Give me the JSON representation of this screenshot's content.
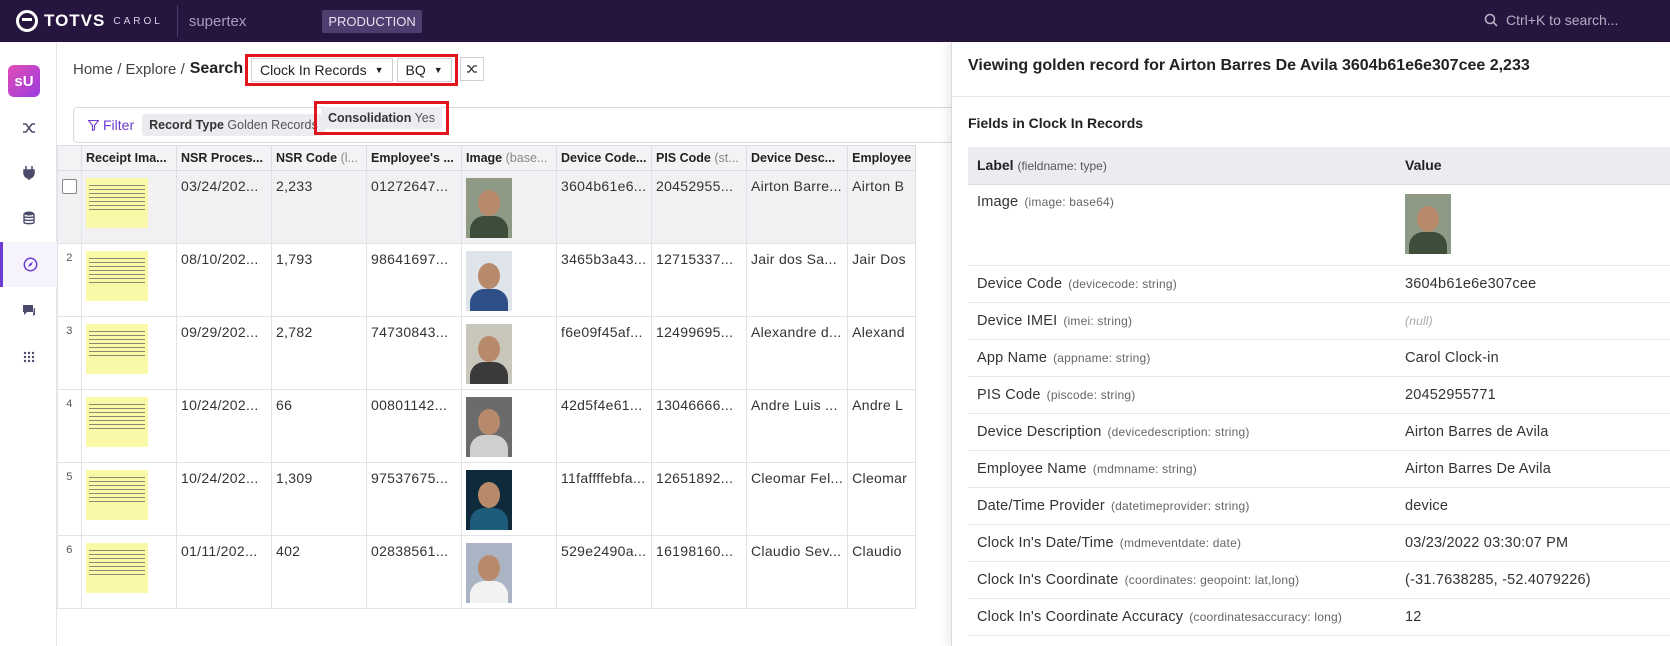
{
  "topbar": {
    "logo_text": "TOTVS",
    "logo_sub": "CAROL",
    "tenant": "supertex",
    "environment": "PRODUCTION",
    "search_placeholder": "Ctrl+K to search..."
  },
  "sidebar": {
    "badge": "sU",
    "items": [
      "shuffle-icon",
      "plug-icon",
      "database-icon",
      "compass-icon",
      "chat-icon",
      "apps-grid-icon"
    ],
    "active": "compass-icon"
  },
  "breadcrumb": {
    "home": "Home",
    "sep1": "/",
    "explore": "Explore",
    "sep2": "/",
    "current": "Search"
  },
  "selectors": {
    "entity": "Clock In Records",
    "source": "BQ"
  },
  "filters": {
    "button": "Filter",
    "chips": [
      {
        "key": "Record Type",
        "value": "Golden Records"
      },
      {
        "key": "Consolidation",
        "value": "Yes"
      }
    ]
  },
  "table": {
    "columns": [
      {
        "name": "Receipt Ima...",
        "type": ""
      },
      {
        "name": "NSR Proces...",
        "type": ""
      },
      {
        "name": "NSR Code",
        "type": "(l..."
      },
      {
        "name": "Employee's ...",
        "type": ""
      },
      {
        "name": "Image",
        "type": "(base..."
      },
      {
        "name": "Device Code...",
        "type": ""
      },
      {
        "name": "PIS Code",
        "type": "(st..."
      },
      {
        "name": "Device Desc...",
        "type": ""
      },
      {
        "name": "Employee",
        "type": ""
      }
    ],
    "rows": [
      {
        "index": "",
        "date": "03/24/202...",
        "nsr": "2,233",
        "emp": "01272647...",
        "device": "3604b61e6...",
        "pis": "20452955...",
        "desc": "Airton Barre...",
        "name": "Airton B",
        "photo_bg": "#8e9a86",
        "shirt": "#3d4d3a",
        "selected": true
      },
      {
        "index": "2",
        "date": "08/10/202...",
        "nsr": "1,793",
        "emp": "98641697...",
        "device": "3465b3a43...",
        "pis": "12715337...",
        "desc": "Jair dos Sa...",
        "name": "Jair Dos",
        "photo_bg": "#dfe4ea",
        "shirt": "#2e4f87",
        "selected": false
      },
      {
        "index": "3",
        "date": "09/29/202...",
        "nsr": "2,782",
        "emp": "74730843...",
        "device": "f6e09f45af...",
        "pis": "12499695...",
        "desc": "Alexandre d...",
        "name": "Alexand",
        "photo_bg": "#c9c6bc",
        "shirt": "#3a3a3a",
        "selected": false
      },
      {
        "index": "4",
        "date": "10/24/202...",
        "nsr": "66",
        "emp": "00801142...",
        "device": "42d5f4e61...",
        "pis": "13046666...",
        "desc": "Andre Luis ...",
        "name": "Andre L",
        "photo_bg": "#6b6b6b",
        "shirt": "#cfcfcf",
        "selected": false
      },
      {
        "index": "5",
        "date": "10/24/202...",
        "nsr": "1,309",
        "emp": "97537675...",
        "device": "11faffffebfa...",
        "pis": "12651892...",
        "desc": "Cleomar Fel...",
        "name": "Cleomar",
        "photo_bg": "#0f2a3a",
        "shirt": "#1f5b7a",
        "selected": false
      },
      {
        "index": "6",
        "date": "01/11/202...",
        "nsr": "402",
        "emp": "02838561...",
        "device": "529e2490a...",
        "pis": "16198160...",
        "desc": "Claudio Sev...",
        "name": "Claudio",
        "photo_bg": "#aab4c4",
        "shirt": "#f2f2f2",
        "selected": false
      }
    ]
  },
  "panel": {
    "title": "Viewing golden record for Airton Barres De Avila 3604b61e6e307cee 2,233",
    "subtitle": "Fields in Clock In Records",
    "header_label": "Label",
    "header_label_hint": "(fieldname: type)",
    "header_value": "Value",
    "fields": [
      {
        "label": "Image",
        "type": "(image: base64)",
        "value": ""
      },
      {
        "label": "Device Code",
        "type": "(devicecode: string)",
        "value": "3604b61e6e307cee"
      },
      {
        "label": "Device IMEI",
        "type": "(imei: string)",
        "value": "(null)"
      },
      {
        "label": "App Name",
        "type": "(appname: string)",
        "value": "Carol Clock-in"
      },
      {
        "label": "PIS Code",
        "type": "(piscode: string)",
        "value": "20452955771"
      },
      {
        "label": "Device Description",
        "type": "(devicedescription: string)",
        "value": "Airton Barres de Avila"
      },
      {
        "label": "Employee Name",
        "type": "(mdmname: string)",
        "value": "Airton Barres De Avila"
      },
      {
        "label": "Date/Time Provider",
        "type": "(datetimeprovider: string)",
        "value": "device"
      },
      {
        "label": "Clock In's Date/Time",
        "type": "(mdmeventdate: date)",
        "value": "03/23/2022 03:30:07 PM"
      },
      {
        "label": "Clock In's Coordinate",
        "type": "(coordinates: geopoint: lat,long)",
        "value": "(-31.7638285, -52.4079226)"
      },
      {
        "label": "Clock In's Coordinate Accuracy",
        "type": "(coordinatesaccuracy: long)",
        "value": "12"
      }
    ]
  },
  "colors": {
    "topbar": "#26163f",
    "accent": "#6c3bd1",
    "highlight": "#e0161c",
    "receipt": "#f9f9a8"
  }
}
